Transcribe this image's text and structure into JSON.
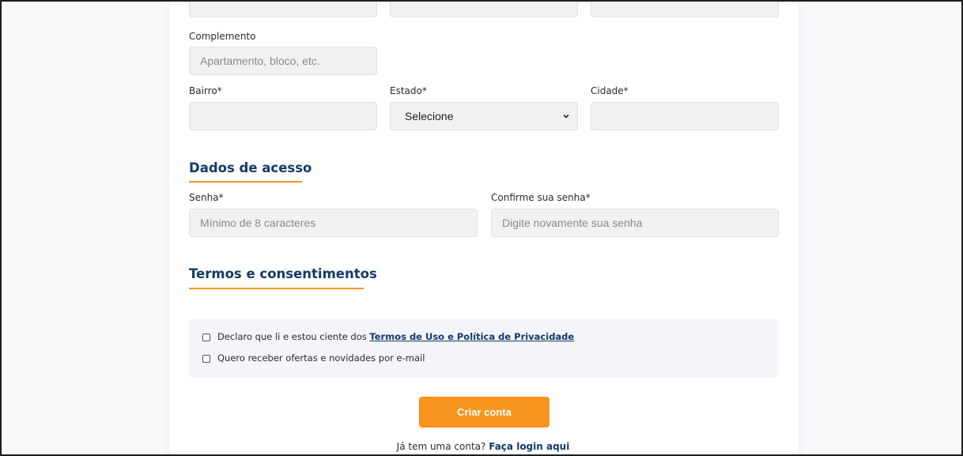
{
  "address": {
    "complemento": {
      "label": "Complemento",
      "placeholder": "Apartamento, bloco, etc."
    },
    "bairro": {
      "label": "Bairro*",
      "value": ""
    },
    "estado": {
      "label": "Estado*",
      "selected": "Selecione"
    },
    "cidade": {
      "label": "Cidade*",
      "value": ""
    }
  },
  "access": {
    "title": "Dados de acesso",
    "senha": {
      "label": "Senha*",
      "placeholder": "Mínimo de 8 caracteres"
    },
    "confirm": {
      "label": "Confirme sua senha*",
      "placeholder": "Digite novamente sua senha"
    }
  },
  "terms": {
    "title": "Termos e consentimentos",
    "consent1_text": "Declaro que li e estou ciente dos ",
    "consent1_link": "Termos de Uso e Política de Privacidade",
    "consent2_text": "Quero receber ofertas e novidades por e-mail"
  },
  "submit_label": "Criar conta",
  "login": {
    "prompt": "Já tem uma conta?",
    "link": "Faça login aqui"
  },
  "colors": {
    "accent": "#f7941d",
    "title": "#123a6b",
    "field_bg": "#f1f1f1"
  },
  "icons": {
    "select_arrow": "chevron-down-icon",
    "checkbox": "checkbox-icon"
  }
}
